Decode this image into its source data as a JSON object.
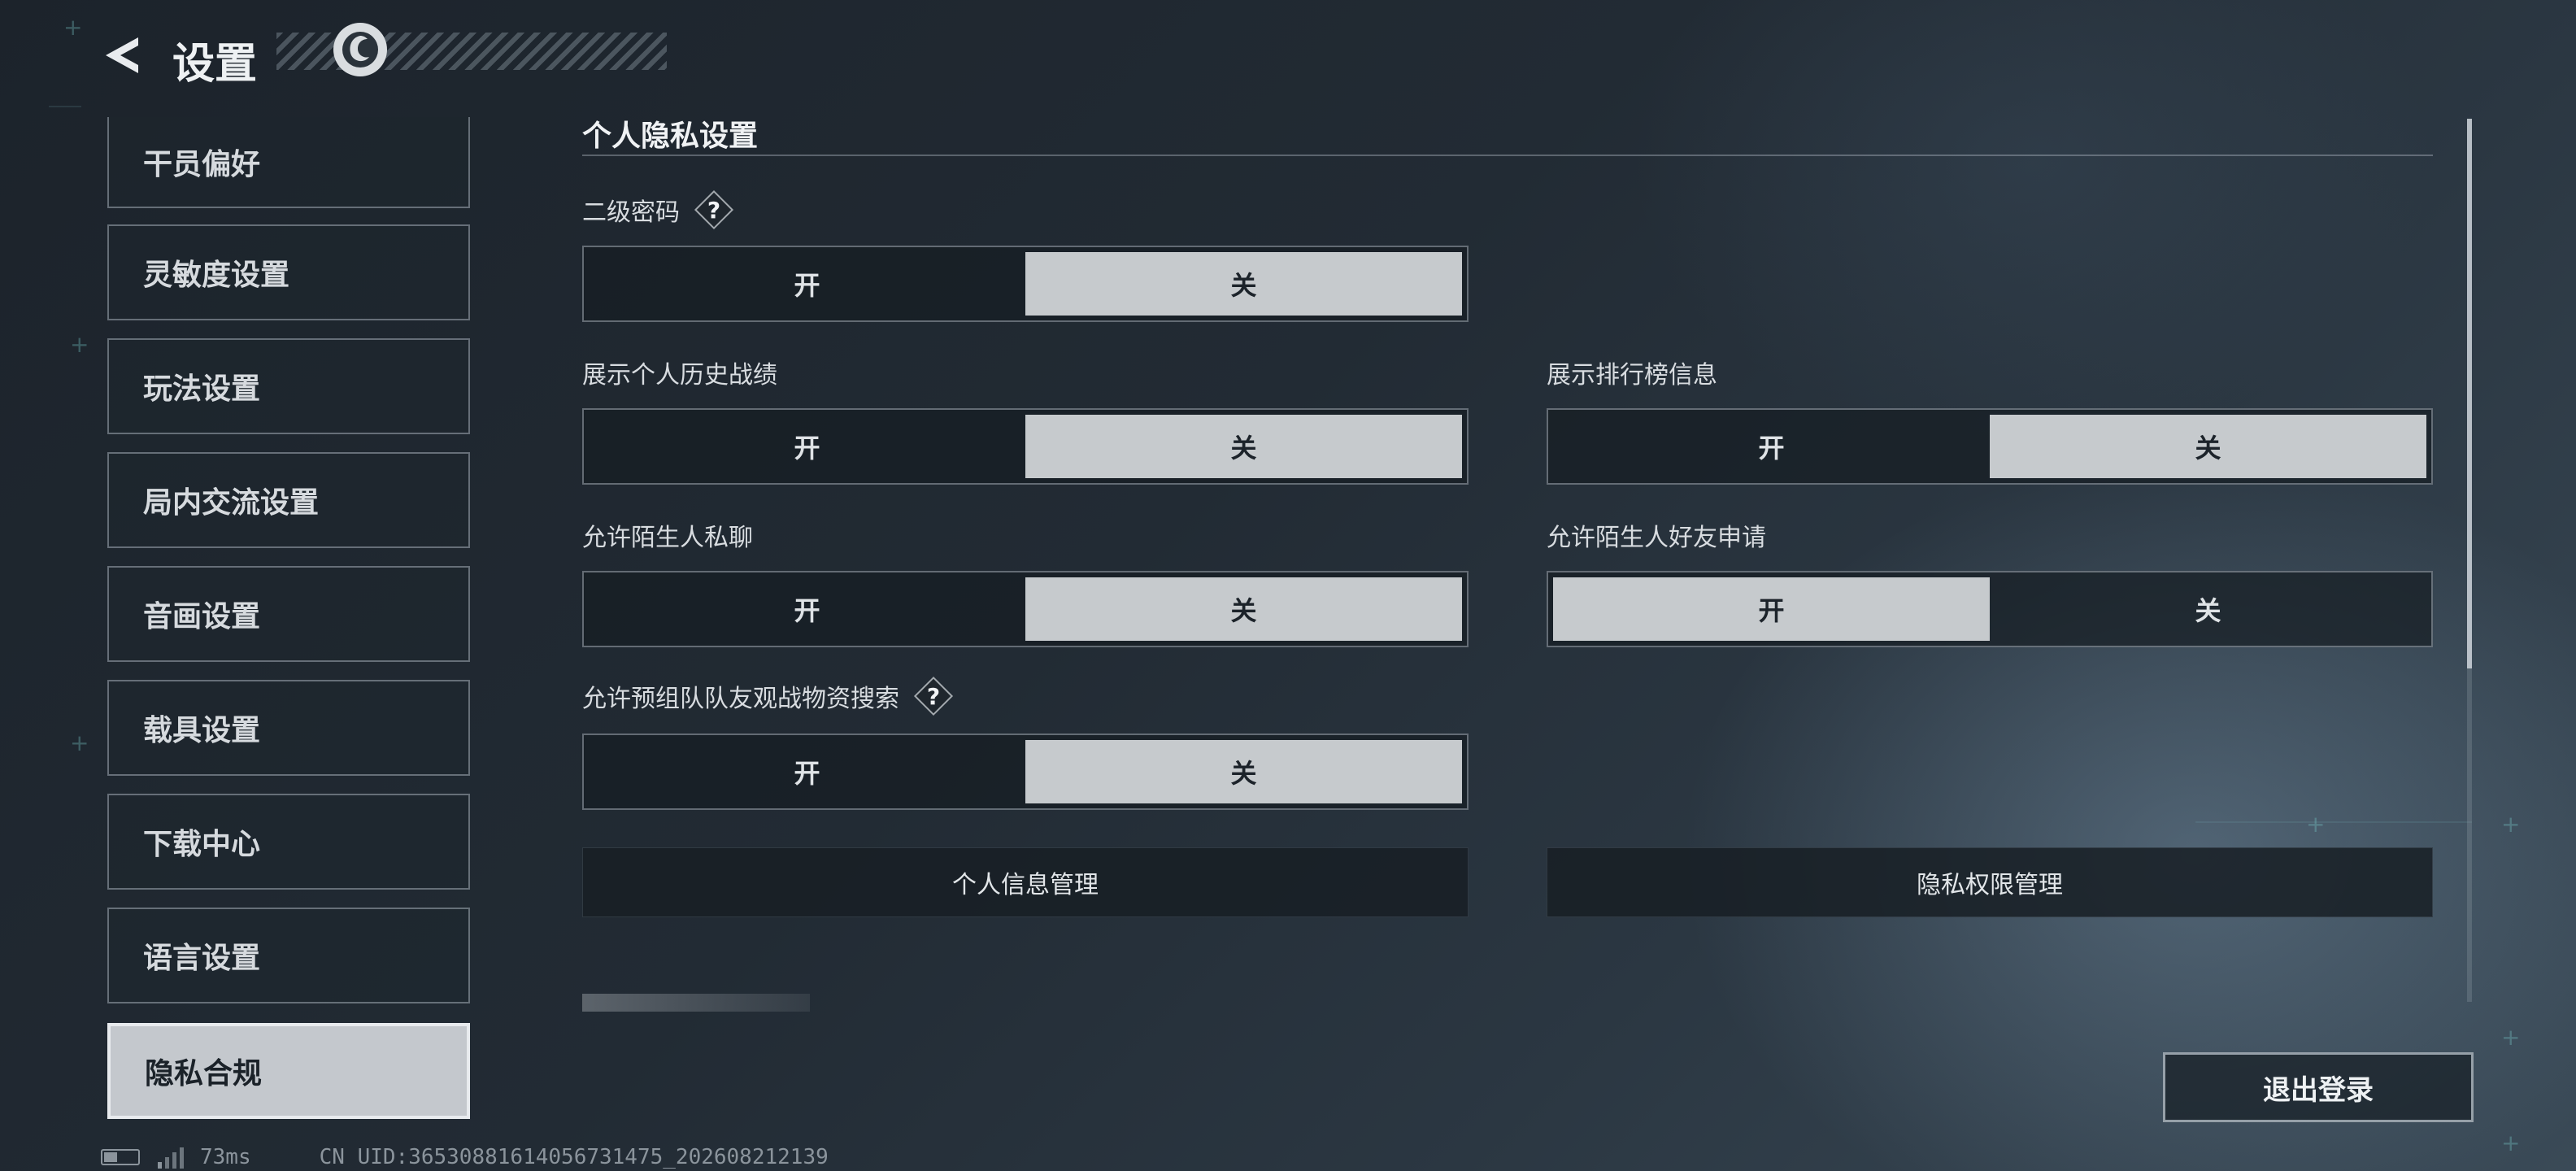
{
  "header": {
    "title": "设置",
    "back_icon": "back-arrow-icon",
    "logo_icon": "game-logo-icon"
  },
  "sidebar": {
    "items": [
      {
        "label": "干员偏好"
      },
      {
        "label": "灵敏度设置"
      },
      {
        "label": "玩法设置"
      },
      {
        "label": "局内交流设置"
      },
      {
        "label": "音画设置"
      },
      {
        "label": "载具设置"
      },
      {
        "label": "下载中心"
      },
      {
        "label": "语言设置"
      },
      {
        "label": "隐私合规",
        "active": true
      }
    ]
  },
  "main": {
    "section_title": "个人隐私设置",
    "on_label": "开",
    "off_label": "关",
    "settings": [
      {
        "label": "二级密码",
        "has_help": true,
        "value": "关"
      },
      {
        "label": "展示个人历史战绩",
        "value": "关"
      },
      {
        "label": "展示排行榜信息",
        "value": "关"
      },
      {
        "label": "允许陌生人私聊",
        "value": "关"
      },
      {
        "label": "允许陌生人好友申请",
        "value": "开"
      },
      {
        "label": "允许预组队队友观战物资搜索",
        "has_help": true,
        "value": "关"
      }
    ],
    "help_glyph": "?",
    "buttons": {
      "personal_info": "个人信息管理",
      "privacy_permissions": "隐私权限管理"
    },
    "logout": "退出登录"
  },
  "status_bar": {
    "ping": "73ms",
    "uid": "CN UID:3653088161405673147​5_202608212139"
  }
}
